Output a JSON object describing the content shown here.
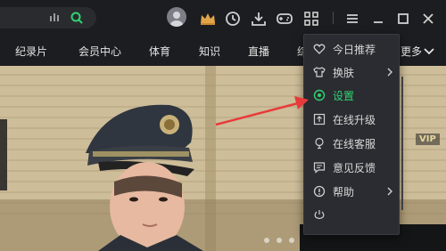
{
  "topbar": {
    "icons": [
      "voice-search-icon",
      "search-icon",
      "avatar",
      "vip-crown-icon",
      "history-icon",
      "download-icon",
      "game-icon",
      "apps-grid-icon",
      "menu-icon",
      "minimize-icon",
      "maximize-icon",
      "close-icon"
    ]
  },
  "nav": {
    "items": [
      "纪录片",
      "会员中心",
      "体育",
      "知识",
      "直播",
      "综"
    ],
    "more": "更多"
  },
  "hero": {
    "vip_badge": "VIP",
    "carousel_dots": 3
  },
  "menu": {
    "items": [
      {
        "label": "今日推荐",
        "icon": "heart-icon",
        "submenu": false,
        "active": false
      },
      {
        "label": "换肤",
        "icon": "shirt-icon",
        "submenu": true,
        "active": false
      },
      {
        "label": "设置",
        "icon": "settings-icon",
        "submenu": false,
        "active": true
      },
      {
        "label": "在线升级",
        "icon": "upgrade-icon",
        "submenu": false,
        "active": false
      },
      {
        "label": "在线客服",
        "icon": "support-icon",
        "submenu": false,
        "active": false
      },
      {
        "label": "意见反馈",
        "icon": "feedback-icon",
        "submenu": false,
        "active": false
      },
      {
        "label": "帮助",
        "icon": "help-icon",
        "submenu": true,
        "active": false
      }
    ]
  },
  "colors": {
    "accent_green": "#2dd36f",
    "annotation_arrow": "#e83a3a",
    "menu_bg": "#2b2c31",
    "topbar_bg": "#1c1d20"
  }
}
